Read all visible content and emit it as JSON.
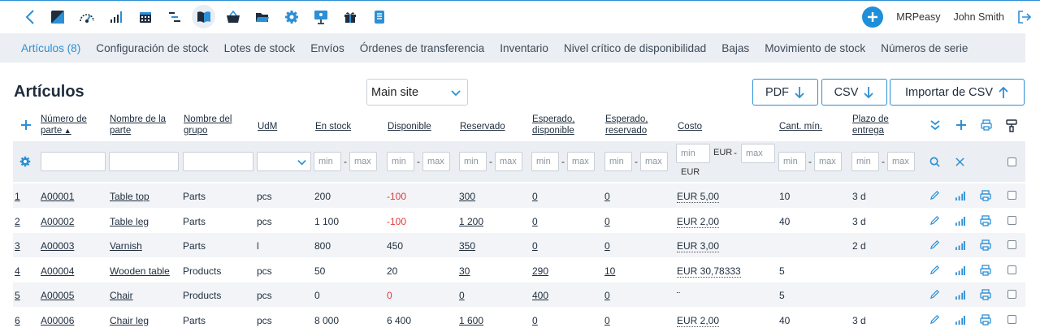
{
  "topbar": {
    "icons": [
      "dashboard-icon",
      "speedometer-icon",
      "bar-chart-icon",
      "calendar-icon",
      "gantt-icon",
      "book-icon",
      "basket-icon",
      "folder-icon",
      "gear-icon",
      "presentation-icon",
      "gift-icon",
      "document-icon"
    ],
    "app_name": "MRPeasy",
    "user_name": "John Smith"
  },
  "tabs": [
    "Artículos (8)",
    "Configuración de stock",
    "Lotes de stock",
    "Envíos",
    "Órdenes de transferencia",
    "Inventario",
    "Nivel crítico de disponibilidad",
    "Bajas",
    "Movimiento de stock",
    "Números de serie"
  ],
  "page": {
    "title": "Artículos",
    "site": "Main site",
    "pdf_label": "PDF",
    "csv_label": "CSV",
    "import_label": "Importar de CSV"
  },
  "columns": {
    "part_no": [
      "Número de",
      "parte"
    ],
    "part_name": [
      "Nombre de la",
      "parte"
    ],
    "group_name": [
      "Nombre del",
      "grupo"
    ],
    "uom": [
      "UdM"
    ],
    "in_stock": [
      "En stock"
    ],
    "available": [
      "Disponible"
    ],
    "reserved": [
      "Reservado"
    ],
    "exp_available": [
      "Esperado,",
      "disponible"
    ],
    "exp_reserved": [
      "Esperado,",
      "reservado"
    ],
    "cost": [
      "Costo"
    ],
    "min_qty": [
      "Cant. mín."
    ],
    "lead_time": [
      "Plazo de",
      "entrega"
    ]
  },
  "filters": {
    "min_placeholder": "min",
    "max_placeholder": "max",
    "currency": "EUR"
  },
  "rows": [
    {
      "n": "1",
      "part_no": "A00001",
      "name": "Table top",
      "group": "Parts",
      "uom": "pcs",
      "in_stock": "200",
      "available": "-100",
      "available_neg": true,
      "reserved": "300",
      "exp_avail": "0",
      "exp_res": "0",
      "cost": "EUR 5,00",
      "min": "10",
      "lead": "3 d"
    },
    {
      "n": "2",
      "part_no": "A00002",
      "name": "Table leg",
      "group": "Parts",
      "uom": "pcs",
      "in_stock": "1 100",
      "available": "-100",
      "available_neg": true,
      "reserved": "1 200",
      "exp_avail": "0",
      "exp_res": "0",
      "cost": "EUR 2,00",
      "min": "40",
      "lead": "3 d"
    },
    {
      "n": "3",
      "part_no": "A00003",
      "name": "Varnish",
      "group": "Parts",
      "uom": "l",
      "in_stock": "800",
      "available": "450",
      "available_neg": false,
      "reserved": "350",
      "exp_avail": "0",
      "exp_res": "0",
      "cost": "EUR 3,00",
      "min": "",
      "lead": "2 d"
    },
    {
      "n": "4",
      "part_no": "A00004",
      "name": "Wooden table",
      "group": "Products",
      "uom": "pcs",
      "in_stock": "50",
      "available": "20",
      "available_neg": false,
      "reserved": "30",
      "exp_avail": "290",
      "exp_res": "10",
      "cost": "EUR 30,78333",
      "min": "5",
      "lead": ""
    },
    {
      "n": "5",
      "part_no": "A00005",
      "name": "Chair",
      "group": "Products",
      "uom": "pcs",
      "in_stock": "0",
      "available": "0",
      "available_neg": true,
      "reserved": "0",
      "exp_avail": "400",
      "exp_res": "0",
      "cost": "",
      "min": "5",
      "lead": ""
    },
    {
      "n": "6",
      "part_no": "A00006",
      "name": "Chair leg",
      "group": "Parts",
      "uom": "pcs",
      "in_stock": "8 000",
      "available": "6 400",
      "available_neg": false,
      "reserved": "1 600",
      "exp_avail": "0",
      "exp_res": "0",
      "cost": "EUR 2,00",
      "min": "40",
      "lead": "3 d"
    }
  ],
  "colors": {
    "accent": "#2d8fd5",
    "negative": "#e03a3a",
    "band": "#ebeef2"
  }
}
